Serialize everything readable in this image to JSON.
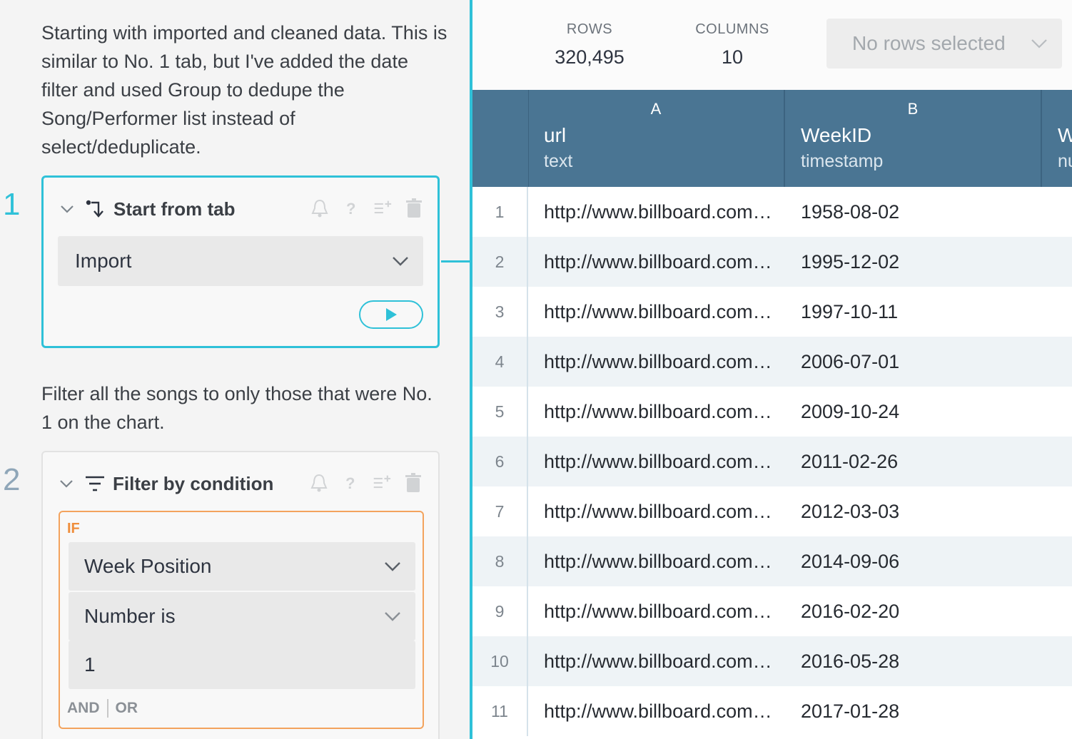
{
  "workflow": {
    "note1": "Starting with imported and cleaned data. This is similar to No. 1 tab, but I've added the date filter and used Group to dedupe the Song/Performer list instead of select/deduplicate.",
    "note2": "Filter all the songs to only those that were No. 1 on the chart.",
    "step1": {
      "number": "1",
      "title": "Start from tab",
      "icon": "start-from-tab-icon",
      "tab_value": "Import"
    },
    "step2": {
      "number": "2",
      "title": "Filter by condition",
      "icon": "filter-icon",
      "if_label": "IF",
      "column_value": "Week Position",
      "condition_value": "Number is",
      "value": "1",
      "and_label": "AND",
      "or_label": "OR"
    },
    "accent_color": "#2fc1d8",
    "condition_color": "#f3a35d"
  },
  "table": {
    "rows_label": "ROWS",
    "rows_value": "320,495",
    "columns_label": "COLUMNS",
    "columns_value": "10",
    "selection_label": "No rows selected",
    "header_color": "#4a7593",
    "columns": [
      {
        "letter": "A",
        "name": "url",
        "type": "text"
      },
      {
        "letter": "B",
        "name": "WeekID",
        "type": "timestamp"
      },
      {
        "letter": "",
        "name": "W",
        "type": "nu"
      }
    ],
    "rows": [
      {
        "n": "1",
        "url": "http://www.billboard.com…",
        "week": "1958-08-02"
      },
      {
        "n": "2",
        "url": "http://www.billboard.com…",
        "week": "1995-12-02"
      },
      {
        "n": "3",
        "url": "http://www.billboard.com…",
        "week": "1997-10-11"
      },
      {
        "n": "4",
        "url": "http://www.billboard.com…",
        "week": "2006-07-01"
      },
      {
        "n": "5",
        "url": "http://www.billboard.com…",
        "week": "2009-10-24"
      },
      {
        "n": "6",
        "url": "http://www.billboard.com…",
        "week": "2011-02-26"
      },
      {
        "n": "7",
        "url": "http://www.billboard.com…",
        "week": "2012-03-03"
      },
      {
        "n": "8",
        "url": "http://www.billboard.com…",
        "week": "2014-09-06"
      },
      {
        "n": "9",
        "url": "http://www.billboard.com…",
        "week": "2016-02-20"
      },
      {
        "n": "10",
        "url": "http://www.billboard.com…",
        "week": "2016-05-28"
      },
      {
        "n": "11",
        "url": "http://www.billboard.com…",
        "week": "2017-01-28"
      }
    ]
  }
}
